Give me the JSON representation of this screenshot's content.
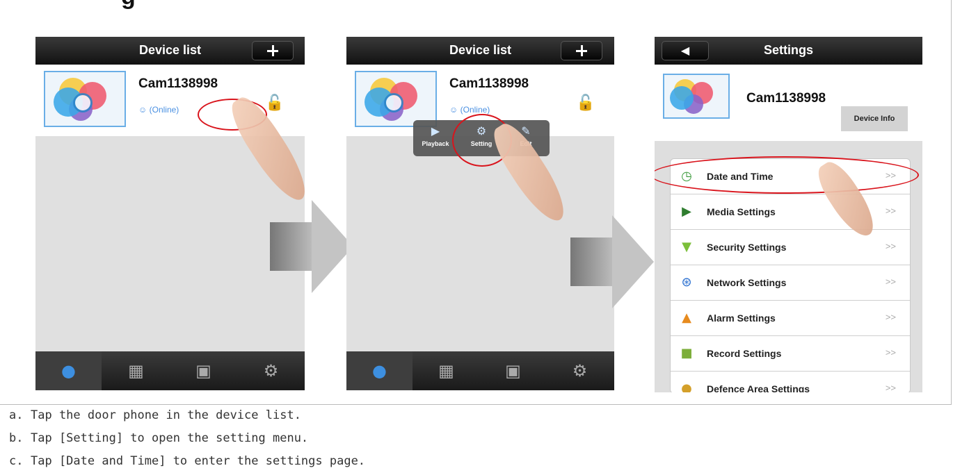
{
  "page": {
    "title_fragment": "g"
  },
  "panel1": {
    "header_title": "Device list",
    "device_name": "Cam1138998",
    "status": "(Online)",
    "lock_icon": "unlock-icon"
  },
  "panel2": {
    "header_title": "Device list",
    "device_name": "Cam1138998",
    "status": "(Online)",
    "popup": {
      "playback": "Playback",
      "setting": "Setting",
      "edit": "Edit"
    }
  },
  "panel3": {
    "header_title": "Settings",
    "device_name": "Cam1138998",
    "device_info": "Device Info",
    "menu": [
      {
        "label": "Date and Time",
        "icon": "clock-icon",
        "chev": ">>"
      },
      {
        "label": "Media Settings",
        "icon": "media-icon",
        "chev": ">>"
      },
      {
        "label": "Security Settings",
        "icon": "shield-icon",
        "chev": ">>"
      },
      {
        "label": "Network Settings",
        "icon": "antenna-icon",
        "chev": ">>"
      },
      {
        "label": "Alarm Settings",
        "icon": "bell-icon",
        "chev": ">>"
      },
      {
        "label": "Record Settings",
        "icon": "camera-icon",
        "chev": ">>"
      },
      {
        "label": "Defence Area Settings",
        "icon": "lock-icon",
        "chev": ">>"
      }
    ]
  },
  "tabs": [
    {
      "icon": "person-icon"
    },
    {
      "icon": "grid-icon"
    },
    {
      "icon": "toolbox-icon"
    },
    {
      "icon": "gear-icon"
    }
  ],
  "instructions": [
    {
      "letter": "a.",
      "text": "Tap the door phone in the device list."
    },
    {
      "letter": "b.",
      "text": "Tap [Setting] to open the setting menu."
    },
    {
      "letter": "c.",
      "text": "Tap [Date and Time] to enter the settings page."
    }
  ],
  "colors": {
    "highlight": "#d9141c",
    "accent": "#3d8fe0"
  }
}
